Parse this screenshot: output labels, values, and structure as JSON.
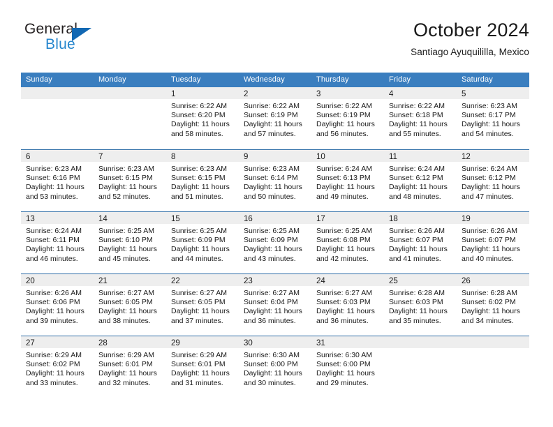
{
  "brand": {
    "name_top": "General",
    "name_bottom": "Blue",
    "accent_color": "#1268b3",
    "accent_light": "#2787ce"
  },
  "header": {
    "title": "October 2024",
    "subtitle": "Santiago Ayuquililla, Mexico"
  },
  "theme": {
    "header_band": "#3a7ebf",
    "row_rule": "#2c6ca6",
    "day_band": "#eeeeee"
  },
  "calendar": {
    "weekdays": [
      "Sunday",
      "Monday",
      "Tuesday",
      "Wednesday",
      "Thursday",
      "Friday",
      "Saturday"
    ],
    "weeks": [
      [
        {
          "day": "",
          "lines": []
        },
        {
          "day": "",
          "lines": []
        },
        {
          "day": "1",
          "lines": [
            "Sunrise: 6:22 AM",
            "Sunset: 6:20 PM",
            "Daylight: 11 hours",
            "and 58 minutes."
          ]
        },
        {
          "day": "2",
          "lines": [
            "Sunrise: 6:22 AM",
            "Sunset: 6:19 PM",
            "Daylight: 11 hours",
            "and 57 minutes."
          ]
        },
        {
          "day": "3",
          "lines": [
            "Sunrise: 6:22 AM",
            "Sunset: 6:19 PM",
            "Daylight: 11 hours",
            "and 56 minutes."
          ]
        },
        {
          "day": "4",
          "lines": [
            "Sunrise: 6:22 AM",
            "Sunset: 6:18 PM",
            "Daylight: 11 hours",
            "and 55 minutes."
          ]
        },
        {
          "day": "5",
          "lines": [
            "Sunrise: 6:23 AM",
            "Sunset: 6:17 PM",
            "Daylight: 11 hours",
            "and 54 minutes."
          ]
        }
      ],
      [
        {
          "day": "6",
          "lines": [
            "Sunrise: 6:23 AM",
            "Sunset: 6:16 PM",
            "Daylight: 11 hours",
            "and 53 minutes."
          ]
        },
        {
          "day": "7",
          "lines": [
            "Sunrise: 6:23 AM",
            "Sunset: 6:15 PM",
            "Daylight: 11 hours",
            "and 52 minutes."
          ]
        },
        {
          "day": "8",
          "lines": [
            "Sunrise: 6:23 AM",
            "Sunset: 6:15 PM",
            "Daylight: 11 hours",
            "and 51 minutes."
          ]
        },
        {
          "day": "9",
          "lines": [
            "Sunrise: 6:23 AM",
            "Sunset: 6:14 PM",
            "Daylight: 11 hours",
            "and 50 minutes."
          ]
        },
        {
          "day": "10",
          "lines": [
            "Sunrise: 6:24 AM",
            "Sunset: 6:13 PM",
            "Daylight: 11 hours",
            "and 49 minutes."
          ]
        },
        {
          "day": "11",
          "lines": [
            "Sunrise: 6:24 AM",
            "Sunset: 6:12 PM",
            "Daylight: 11 hours",
            "and 48 minutes."
          ]
        },
        {
          "day": "12",
          "lines": [
            "Sunrise: 6:24 AM",
            "Sunset: 6:12 PM",
            "Daylight: 11 hours",
            "and 47 minutes."
          ]
        }
      ],
      [
        {
          "day": "13",
          "lines": [
            "Sunrise: 6:24 AM",
            "Sunset: 6:11 PM",
            "Daylight: 11 hours",
            "and 46 minutes."
          ]
        },
        {
          "day": "14",
          "lines": [
            "Sunrise: 6:25 AM",
            "Sunset: 6:10 PM",
            "Daylight: 11 hours",
            "and 45 minutes."
          ]
        },
        {
          "day": "15",
          "lines": [
            "Sunrise: 6:25 AM",
            "Sunset: 6:09 PM",
            "Daylight: 11 hours",
            "and 44 minutes."
          ]
        },
        {
          "day": "16",
          "lines": [
            "Sunrise: 6:25 AM",
            "Sunset: 6:09 PM",
            "Daylight: 11 hours",
            "and 43 minutes."
          ]
        },
        {
          "day": "17",
          "lines": [
            "Sunrise: 6:25 AM",
            "Sunset: 6:08 PM",
            "Daylight: 11 hours",
            "and 42 minutes."
          ]
        },
        {
          "day": "18",
          "lines": [
            "Sunrise: 6:26 AM",
            "Sunset: 6:07 PM",
            "Daylight: 11 hours",
            "and 41 minutes."
          ]
        },
        {
          "day": "19",
          "lines": [
            "Sunrise: 6:26 AM",
            "Sunset: 6:07 PM",
            "Daylight: 11 hours",
            "and 40 minutes."
          ]
        }
      ],
      [
        {
          "day": "20",
          "lines": [
            "Sunrise: 6:26 AM",
            "Sunset: 6:06 PM",
            "Daylight: 11 hours",
            "and 39 minutes."
          ]
        },
        {
          "day": "21",
          "lines": [
            "Sunrise: 6:27 AM",
            "Sunset: 6:05 PM",
            "Daylight: 11 hours",
            "and 38 minutes."
          ]
        },
        {
          "day": "22",
          "lines": [
            "Sunrise: 6:27 AM",
            "Sunset: 6:05 PM",
            "Daylight: 11 hours",
            "and 37 minutes."
          ]
        },
        {
          "day": "23",
          "lines": [
            "Sunrise: 6:27 AM",
            "Sunset: 6:04 PM",
            "Daylight: 11 hours",
            "and 36 minutes."
          ]
        },
        {
          "day": "24",
          "lines": [
            "Sunrise: 6:27 AM",
            "Sunset: 6:03 PM",
            "Daylight: 11 hours",
            "and 36 minutes."
          ]
        },
        {
          "day": "25",
          "lines": [
            "Sunrise: 6:28 AM",
            "Sunset: 6:03 PM",
            "Daylight: 11 hours",
            "and 35 minutes."
          ]
        },
        {
          "day": "26",
          "lines": [
            "Sunrise: 6:28 AM",
            "Sunset: 6:02 PM",
            "Daylight: 11 hours",
            "and 34 minutes."
          ]
        }
      ],
      [
        {
          "day": "27",
          "lines": [
            "Sunrise: 6:29 AM",
            "Sunset: 6:02 PM",
            "Daylight: 11 hours",
            "and 33 minutes."
          ]
        },
        {
          "day": "28",
          "lines": [
            "Sunrise: 6:29 AM",
            "Sunset: 6:01 PM",
            "Daylight: 11 hours",
            "and 32 minutes."
          ]
        },
        {
          "day": "29",
          "lines": [
            "Sunrise: 6:29 AM",
            "Sunset: 6:01 PM",
            "Daylight: 11 hours",
            "and 31 minutes."
          ]
        },
        {
          "day": "30",
          "lines": [
            "Sunrise: 6:30 AM",
            "Sunset: 6:00 PM",
            "Daylight: 11 hours",
            "and 30 minutes."
          ]
        },
        {
          "day": "31",
          "lines": [
            "Sunrise: 6:30 AM",
            "Sunset: 6:00 PM",
            "Daylight: 11 hours",
            "and 29 minutes."
          ]
        },
        {
          "day": "",
          "lines": []
        },
        {
          "day": "",
          "lines": []
        }
      ]
    ]
  }
}
